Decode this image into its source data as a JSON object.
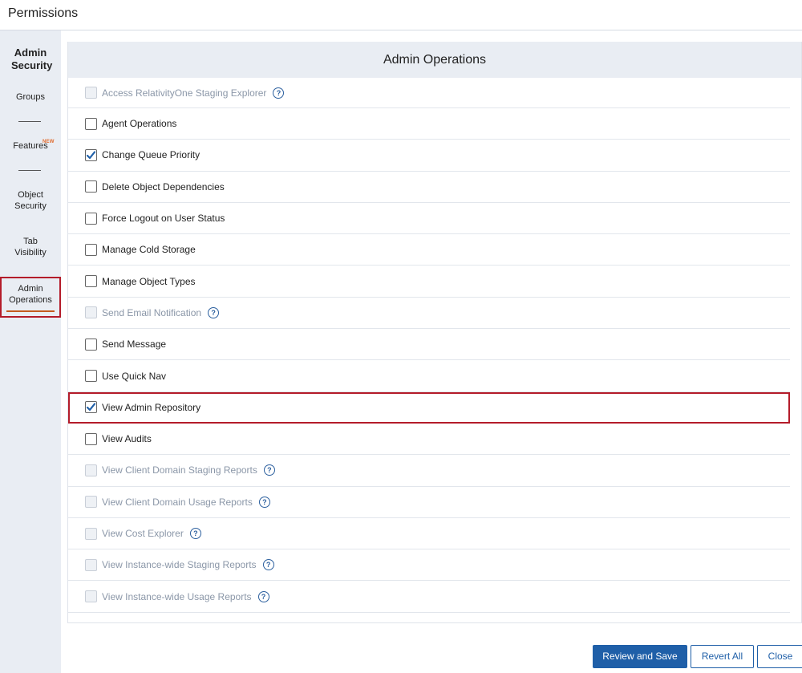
{
  "window": {
    "title": "Permissions"
  },
  "sidebar": {
    "header": "Admin Security",
    "items": [
      {
        "label": "Groups"
      },
      {
        "label": "Features",
        "badge": "NEW"
      },
      {
        "label": "Object Security"
      },
      {
        "label": "Tab Visibility"
      },
      {
        "label": "Admin Operations",
        "active": true
      }
    ]
  },
  "panel": {
    "title": "Admin Operations",
    "rows": [
      {
        "label": "Access RelativityOne Staging Explorer",
        "checked": false,
        "disabled": true,
        "help": true
      },
      {
        "label": "Agent Operations",
        "checked": false,
        "disabled": false,
        "help": false
      },
      {
        "label": "Change Queue Priority",
        "checked": true,
        "disabled": false,
        "help": false
      },
      {
        "label": "Delete Object Dependencies",
        "checked": false,
        "disabled": false,
        "help": false
      },
      {
        "label": "Force Logout on User Status",
        "checked": false,
        "disabled": false,
        "help": false
      },
      {
        "label": "Manage Cold Storage",
        "checked": false,
        "disabled": false,
        "help": false
      },
      {
        "label": "Manage Object Types",
        "checked": false,
        "disabled": false,
        "help": false
      },
      {
        "label": "Send Email Notification",
        "checked": false,
        "disabled": true,
        "help": true
      },
      {
        "label": "Send Message",
        "checked": false,
        "disabled": false,
        "help": false
      },
      {
        "label": "Use Quick Nav",
        "checked": false,
        "disabled": false,
        "help": false
      },
      {
        "label": "View Admin Repository",
        "checked": true,
        "disabled": false,
        "help": false,
        "highlight": true
      },
      {
        "label": "View Audits",
        "checked": false,
        "disabled": false,
        "help": false
      },
      {
        "label": "View Client Domain Staging Reports",
        "checked": false,
        "disabled": true,
        "help": true
      },
      {
        "label": "View Client Domain Usage Reports",
        "checked": false,
        "disabled": true,
        "help": true
      },
      {
        "label": "View Cost Explorer",
        "checked": false,
        "disabled": true,
        "help": true
      },
      {
        "label": "View Instance-wide Staging Reports",
        "checked": false,
        "disabled": true,
        "help": true
      },
      {
        "label": "View Instance-wide Usage Reports",
        "checked": false,
        "disabled": true,
        "help": true
      }
    ]
  },
  "footer": {
    "review_save": "Review and Save",
    "revert_all": "Revert All",
    "close": "Close"
  },
  "help_glyph": "?",
  "colors": {
    "accent": "#1f5fa8",
    "highlight": "#b41c2a",
    "sidebar_bg": "#e9edf3",
    "badge": "#e06a2c"
  }
}
